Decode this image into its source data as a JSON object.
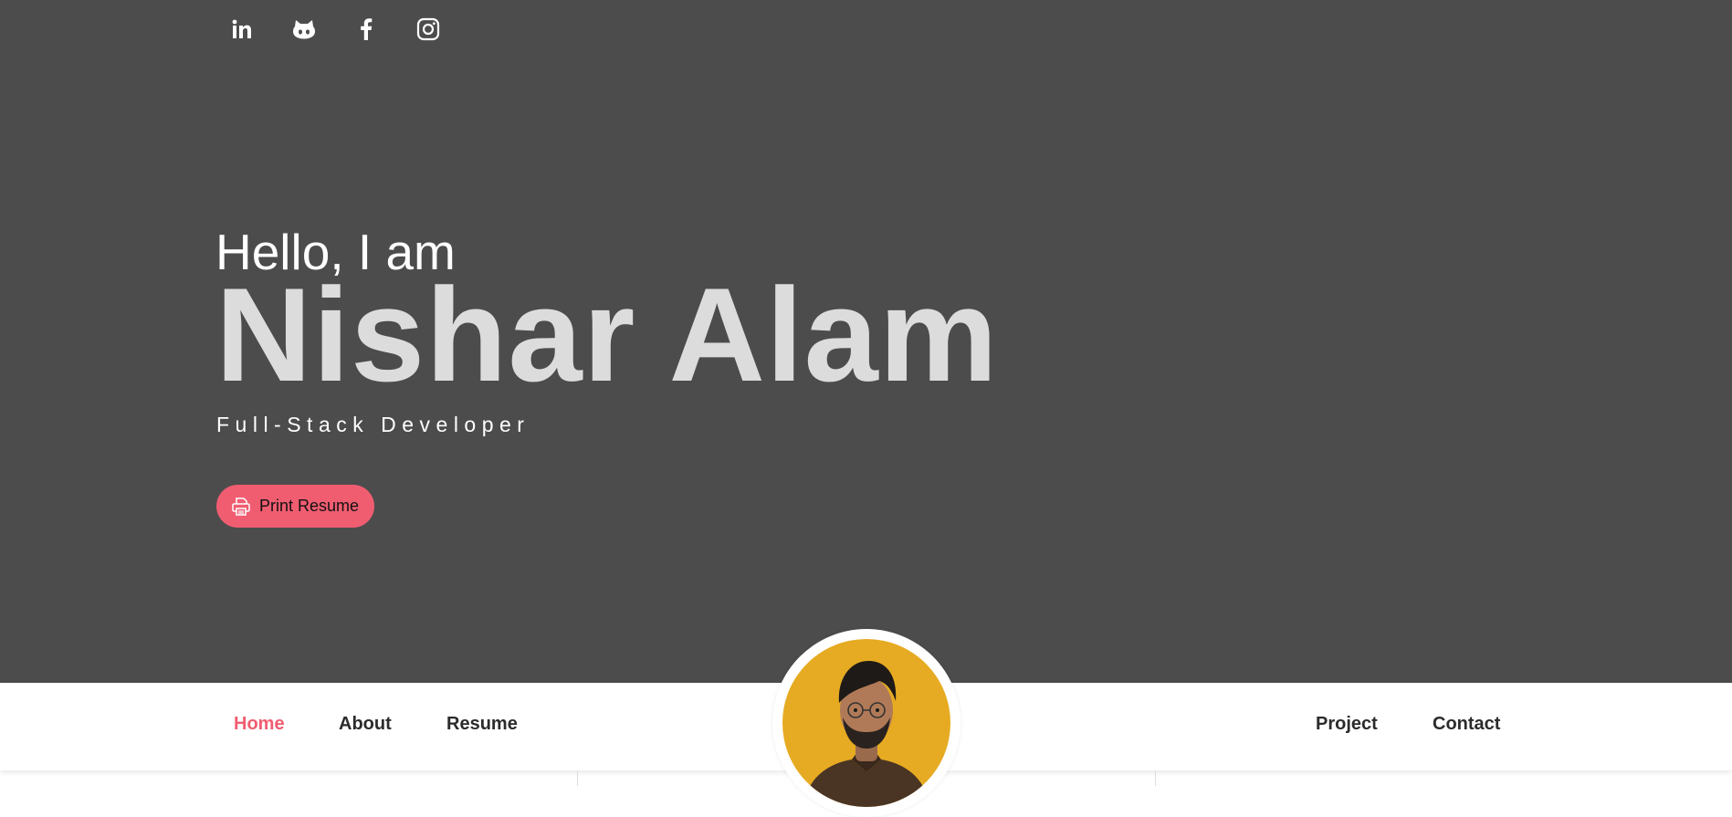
{
  "social": [
    {
      "name": "linkedin-icon",
      "label": "in"
    },
    {
      "name": "github-icon",
      "label": ""
    },
    {
      "name": "facebook-icon",
      "label": "f"
    },
    {
      "name": "instagram-icon",
      "label": ""
    }
  ],
  "hero": {
    "greeting": "Hello, I am",
    "name": "Nishar Alam",
    "role": "Full-Stack Developer",
    "resume_button": "Print Resume"
  },
  "nav": {
    "left": [
      "Home",
      "About",
      "Resume"
    ],
    "right": [
      "Project",
      "Contact"
    ],
    "active": "Home"
  },
  "colors": {
    "hero_bg": "#4c4c4c",
    "accent": "#f05d71",
    "avatar_bg": "#e6ab22",
    "name_text": "#dcdcdc"
  }
}
